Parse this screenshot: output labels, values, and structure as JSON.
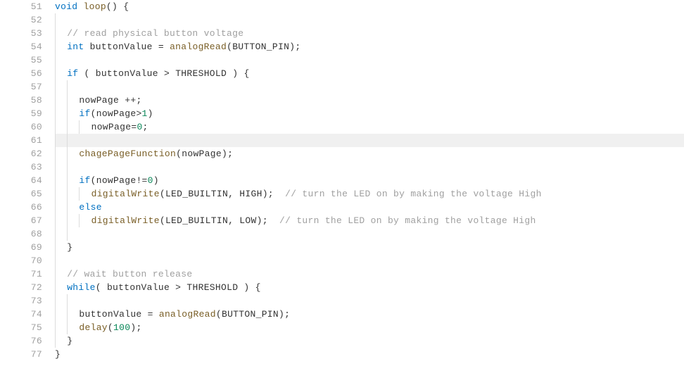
{
  "startLine": 51,
  "highlightLine": 61,
  "tokens": {
    "kw_void": "void",
    "kw_int": "int",
    "kw_if": "if",
    "kw_else": "else",
    "kw_while": "while",
    "fn_loop": "loop",
    "fn_analogRead": "analogRead",
    "fn_chagePageFunction": "chagePageFunction",
    "fn_digitalWrite": "digitalWrite",
    "fn_delay": "delay",
    "id_buttonValue": "buttonValue",
    "id_nowPage": "nowPage",
    "const_BUTTON_PIN": "BUTTON_PIN",
    "const_THRESHOLD": "THRESHOLD",
    "const_LED_BUILTIN": "LED_BUILTIN",
    "const_HIGH": "HIGH",
    "const_LOW": "LOW",
    "num_1": "1",
    "num_0": "0",
    "num_100": "100",
    "cmt_read": "// read physical button voltage",
    "cmt_turnHigh": "// turn the LED on by making the voltage High",
    "cmt_wait": "// wait button release",
    "p_lparen": "(",
    "p_rparen": ")",
    "p_lbrace": "{",
    "p_rbrace": "}",
    "p_semi": ";",
    "p_comma": ",",
    "p_eq": "=",
    "p_gt": ">",
    "p_ne": "!=",
    "p_pp": "++",
    "sp": " "
  },
  "lineNumbers": [
    "51",
    "52",
    "53",
    "54",
    "55",
    "56",
    "57",
    "58",
    "59",
    "60",
    "61",
    "62",
    "63",
    "64",
    "65",
    "66",
    "67",
    "68",
    "69",
    "70",
    "71",
    "72",
    "73",
    "74",
    "75",
    "76",
    "77"
  ]
}
